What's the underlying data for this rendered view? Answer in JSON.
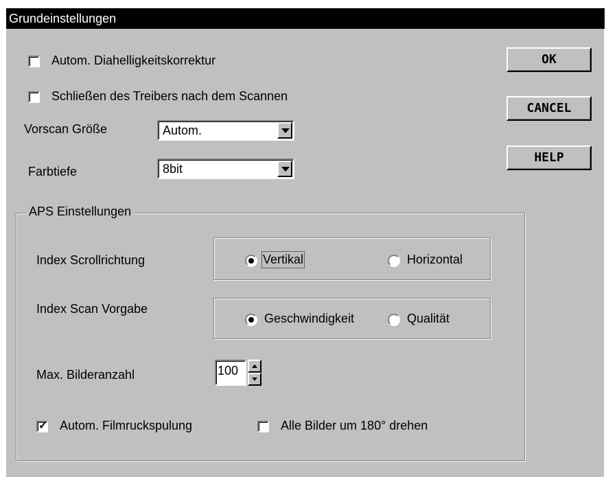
{
  "dialog": {
    "title": "Grundeinstellungen",
    "options": {
      "auto_slide_brightness": {
        "label": "Autom. Diahelligkeitskorrektur",
        "checked": false
      },
      "close_driver_after_scan": {
        "label": "Schließen des Treibers nach dem Scannen",
        "checked": false
      }
    },
    "prescan_size": {
      "label": "Vorscan Größe",
      "value": "Autom."
    },
    "color_depth": {
      "label": "Farbtiefe",
      "value": "8bit"
    },
    "buttons": {
      "ok": "OK",
      "cancel": "CANCEL",
      "help": "HELP"
    },
    "aps": {
      "group_label": "APS Einstellungen",
      "index_scroll": {
        "label": "Index Scrollrichtung",
        "option_vertical": "Vertikal",
        "option_horizontal": "Horizontal",
        "selected": "Vertikal"
      },
      "index_scan": {
        "label": "Index Scan Vorgabe",
        "option_speed": "Geschwindigkeit",
        "option_quality": "Qualität",
        "selected": "Geschwindigkeit"
      },
      "max_images": {
        "label": "Max. Bilderanzahl",
        "value": "100"
      },
      "auto_rewind": {
        "label": "Autom. Filmruckspulung",
        "checked": true
      },
      "rotate_180": {
        "label": "Alle Bilder um 180° drehen",
        "checked": false
      }
    }
  }
}
